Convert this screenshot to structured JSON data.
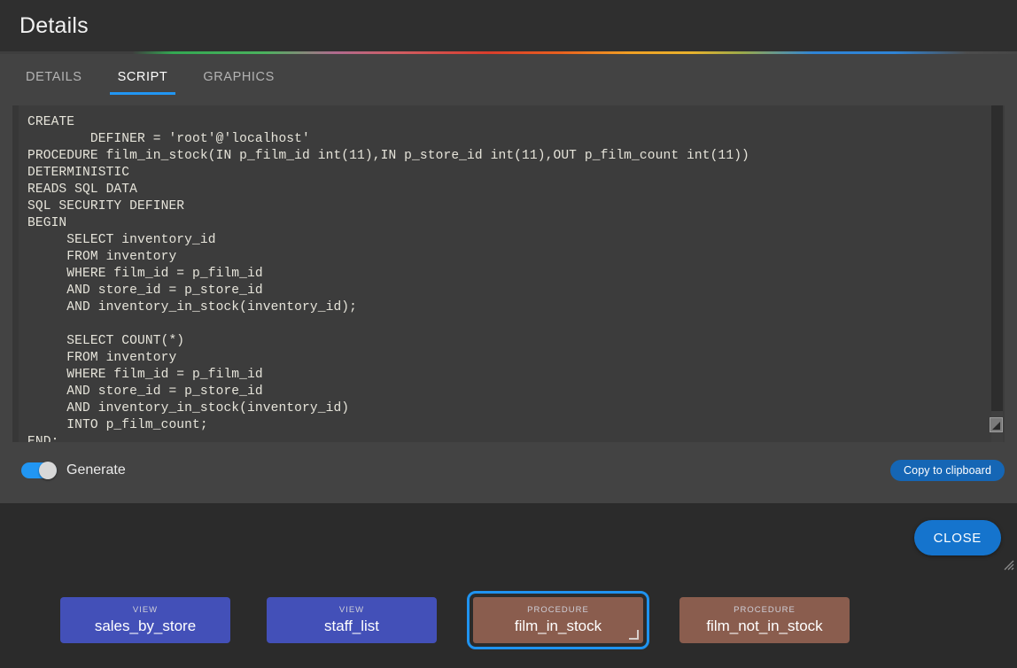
{
  "dialog": {
    "title": "Details",
    "tabs": [
      {
        "label": "DETAILS",
        "active": false
      },
      {
        "label": "SCRIPT",
        "active": true
      },
      {
        "label": "GRAPHICS",
        "active": false
      }
    ],
    "script": "CREATE\n        DEFINER = 'root'@'localhost'\nPROCEDURE film_in_stock(IN p_film_id int(11),IN p_store_id int(11),OUT p_film_count int(11))\nDETERMINISTIC\nREADS SQL DATA\nSQL SECURITY DEFINER\nBEGIN\n     SELECT inventory_id\n     FROM inventory\n     WHERE film_id = p_film_id\n     AND store_id = p_store_id\n     AND inventory_in_stock(inventory_id);\n\n     SELECT COUNT(*)\n     FROM inventory\n     WHERE film_id = p_film_id\n     AND store_id = p_store_id\n     AND inventory_in_stock(inventory_id)\n     INTO p_film_count;\nEND;",
    "generate_label": "Generate",
    "generate_on": true,
    "copy_label": "Copy to clipboard",
    "close_label": "CLOSE",
    "accent_colors": {
      "tab_underline": "#2196f3",
      "primary_button": "#1574cd",
      "copy_button": "#1566b5",
      "toggle_on": "#2196f3"
    }
  },
  "cards": [
    {
      "kind": "VIEW",
      "name": "sales_by_store",
      "type": "view",
      "selected": false
    },
    {
      "kind": "VIEW",
      "name": "staff_list",
      "type": "view",
      "selected": false
    },
    {
      "kind": "PROCEDURE",
      "name": "film_in_stock",
      "type": "procedure",
      "selected": true
    },
    {
      "kind": "PROCEDURE",
      "name": "film_not_in_stock",
      "type": "procedure",
      "selected": false
    }
  ],
  "card_colors": {
    "view": "#4350b8",
    "procedure": "#8a5d4e",
    "selection_ring": "#1f93f0"
  }
}
